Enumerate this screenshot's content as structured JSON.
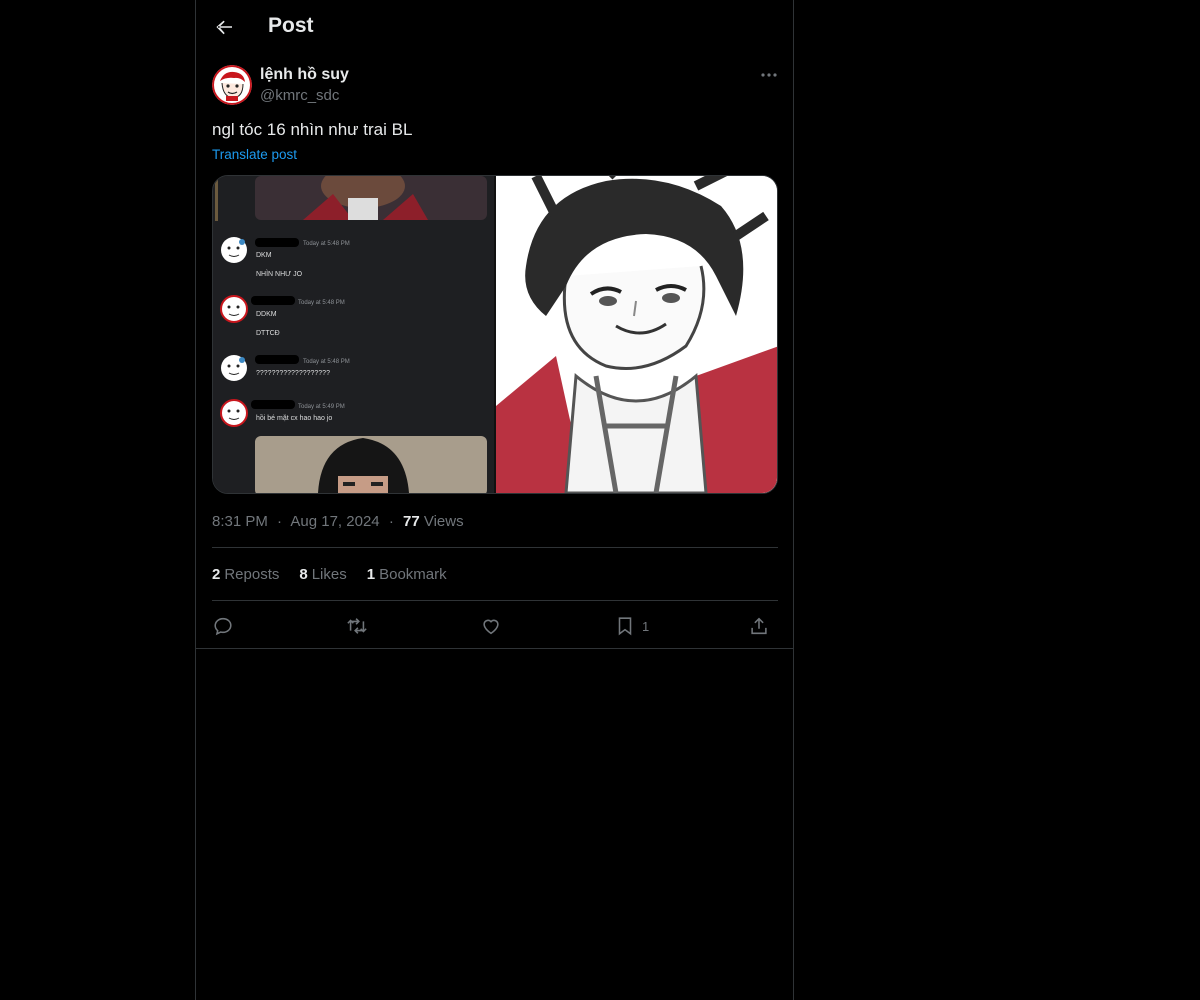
{
  "header": {
    "title": "Post",
    "back_icon": "arrow-left-icon"
  },
  "author": {
    "display_name": "lệnh hồ suy",
    "handle": "@kmrc_sdc",
    "avatar_icon": "avatar-cartoon-face"
  },
  "post": {
    "text": "ngl tóc 16 nhìn như trai BL",
    "translate_label": "Translate post",
    "media": {
      "chat_messages": [
        {
          "time": "Today at 5:48 PM",
          "lines": [
            "DKM",
            "NHÌN NHƯ JO"
          ]
        },
        {
          "time": "Today at 5:48 PM",
          "lines": [
            "DDKM",
            "DTTCĐ"
          ]
        },
        {
          "time": "Today at 5:48 PM",
          "lines": [
            "???????????????????"
          ]
        },
        {
          "time": "Today at 5:49 PM",
          "lines": [
            "hồi bé mặt cx hao hao jo"
          ]
        }
      ]
    }
  },
  "meta": {
    "time": "8:31 PM",
    "dot1": "·",
    "date": "Aug 17, 2024",
    "dot2": "·",
    "views_count": "77",
    "views_label": "Views"
  },
  "stats": {
    "reposts_count": "2",
    "reposts_label": "Reposts",
    "likes_count": "8",
    "likes_label": "Likes",
    "bookmarks_count": "1",
    "bookmarks_label": "Bookmark"
  },
  "actions": {
    "bookmark_count": "1"
  },
  "colors": {
    "background": "#000000",
    "text": "#e7e9ea",
    "muted": "#71767b",
    "link": "#1d9bf0",
    "border": "#2f3336"
  }
}
